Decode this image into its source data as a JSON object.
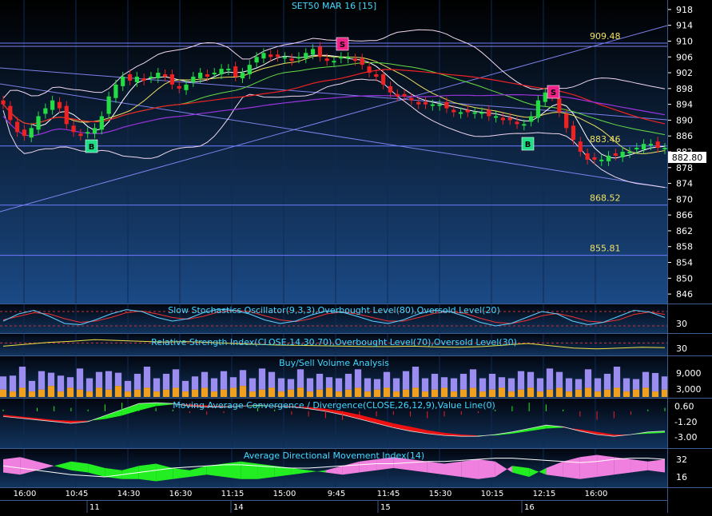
{
  "window": {
    "title": "SET50 MAR 16   [15]",
    "last_price_badge": "882.80"
  },
  "colors": {
    "bg_top": "#000000",
    "bg_bottom": "#1b4a86",
    "grid": "#0f2a55",
    "up_candle": "#22dd44",
    "down_candle": "#ee2222",
    "level_line": "#6c7cff",
    "level_label": "#f0e060",
    "axis_text": "#ffffff",
    "panel_title": "#40d8ff",
    "buy_marker": "#22dd88",
    "sell_marker": "#ee2288"
  },
  "chart_data": [
    {
      "id": "price",
      "type": "candlestick",
      "title": "SET50 MAR 16   [15]",
      "yaxis_ticks": [
        918,
        914,
        910,
        906,
        902,
        898,
        894,
        890,
        886,
        882,
        878,
        874,
        870,
        866,
        862,
        858,
        854,
        850,
        846
      ],
      "ylim": [
        844,
        920
      ],
      "x_ticks": [
        "16:00",
        "10:45",
        "14:30",
        "16:30",
        "11:15",
        "15:00",
        "9:45",
        "11:45",
        "15:30",
        "10:15",
        "12:15",
        "16:00"
      ],
      "date_labels": [
        "11",
        "14",
        "15",
        "16"
      ],
      "levels": [
        {
          "label": "909.48",
          "value": 909.48
        },
        {
          "label": "883.46",
          "value": 883.46
        },
        {
          "label": "868.52",
          "value": 868.52
        },
        {
          "label": "855.81",
          "value": 855.81
        }
      ],
      "last_price": 882.8,
      "closes": [
        894,
        890,
        887,
        886,
        888,
        891,
        893,
        895,
        893,
        889,
        887,
        886,
        887,
        888,
        891,
        896,
        899,
        901,
        900,
        901,
        900,
        901,
        902,
        901,
        899,
        898,
        899,
        901,
        902,
        901,
        902,
        903,
        903,
        901,
        902,
        904,
        906,
        907,
        906,
        906,
        906,
        905,
        906,
        907,
        908,
        906,
        905,
        905,
        906,
        906,
        905,
        904,
        902,
        901,
        899,
        897,
        896,
        896,
        895,
        894,
        894,
        894,
        894,
        893,
        892,
        892,
        892,
        892,
        892,
        891,
        891,
        890,
        890,
        889,
        889,
        891,
        895,
        897,
        896,
        892,
        888,
        885,
        882,
        880,
        880,
        880,
        881,
        881,
        882,
        882,
        883,
        884,
        884,
        883,
        883
      ],
      "signals": [
        {
          "label": "B",
          "type": "buy"
        },
        {
          "label": "S",
          "type": "sell"
        },
        {
          "label": "B",
          "type": "buy"
        },
        {
          "label": "S",
          "type": "sell"
        }
      ],
      "overlays": [
        "bollinger-bands",
        "moving-averages",
        "trend-lines"
      ]
    },
    {
      "id": "stoch",
      "type": "line",
      "title": "Slow Stochastics Oscillator(9,3,3),Overbought Level(80),Oversold Level(20)",
      "yaxis_ticks": [
        30
      ],
      "series": [
        {
          "name": "%K",
          "values": [
            40,
            70,
            85,
            60,
            30,
            25,
            45,
            70,
            88,
            80,
            55,
            40,
            50,
            75,
            90,
            85,
            70,
            45,
            30,
            40,
            65,
            82,
            78,
            60,
            40,
            30,
            45,
            70,
            85,
            80,
            60,
            35,
            20,
            30,
            55,
            80,
            70,
            40,
            25,
            35,
            60,
            85,
            78,
            55
          ]
        },
        {
          "name": "%D",
          "values": [
            45,
            60,
            75,
            70,
            50,
            35,
            40,
            55,
            75,
            82,
            70,
            55,
            48,
            60,
            78,
            85,
            80,
            62,
            45,
            38,
            50,
            70,
            78,
            70,
            55,
            40,
            40,
            55,
            72,
            80,
            72,
            52,
            35,
            30,
            42,
            62,
            72,
            58,
            40,
            35,
            45,
            68,
            78,
            68
          ]
        }
      ]
    },
    {
      "id": "rsi",
      "type": "line",
      "title": "Relative Strength Index(CLOSE,14,30,70),Overbought Level(70),Oversold Level(30)",
      "yaxis_ticks": [
        30
      ],
      "series": [
        {
          "name": "RSI",
          "values": [
            45,
            50,
            55,
            58,
            62,
            60,
            58,
            56,
            57,
            55,
            52,
            50,
            48,
            47,
            46,
            45,
            44,
            44,
            45,
            43,
            42,
            44,
            48,
            52,
            46,
            40,
            38,
            40,
            42,
            41
          ]
        }
      ]
    },
    {
      "id": "volume",
      "type": "bar",
      "title": "Buy/Sell Volume Analysis",
      "yaxis_ticks": [
        "9,000",
        "3,000"
      ],
      "series": [
        {
          "name": "buy",
          "values": [
            5,
            6,
            8,
            4,
            7,
            5,
            6,
            4,
            8,
            5,
            6,
            7,
            5,
            4,
            6,
            8,
            5,
            6,
            7,
            4,
            5,
            6,
            5,
            7,
            4,
            6,
            5,
            8,
            6,
            5,
            4,
            7,
            5,
            6,
            4,
            5,
            6,
            7,
            5,
            4,
            6,
            5,
            7,
            8,
            5,
            6,
            4,
            5,
            6,
            7,
            5,
            6,
            4,
            5,
            7,
            6,
            5,
            8,
            6,
            5,
            4,
            7,
            5,
            6,
            8,
            5,
            4,
            6,
            7,
            5
          ]
        },
        {
          "name": "sell",
          "values": [
            4,
            3,
            5,
            3,
            4,
            6,
            3,
            5,
            4,
            3,
            5,
            4,
            6,
            3,
            4,
            5,
            3,
            4,
            5,
            3,
            4,
            5,
            3,
            4,
            5,
            6,
            3,
            4,
            5,
            3,
            4,
            5,
            3,
            4,
            5,
            3,
            4,
            5,
            3,
            4,
            5,
            3,
            4,
            5,
            3,
            4,
            5,
            3,
            4,
            5,
            3,
            4,
            5,
            3,
            4,
            5,
            3,
            4,
            5,
            3,
            4,
            5,
            3,
            4,
            5,
            3,
            4,
            5,
            3,
            4
          ]
        }
      ]
    },
    {
      "id": "macd",
      "type": "area",
      "title": "Moving Average Convergence / Divergence(CLOSE,26,12,9),Value Line(0)",
      "yaxis_ticks": [
        0.6,
        -1.2,
        -3.0
      ],
      "ylim": [
        -4.0,
        1.2
      ],
      "series": [
        {
          "name": "MACD",
          "values": [
            -0.6,
            -0.8,
            -1.0,
            -1.2,
            -1.4,
            -1.2,
            -0.5,
            0.2,
            0.9,
            1.0,
            0.9,
            0.6,
            0.5,
            0.5,
            0.6,
            0.7,
            0.6,
            0.5,
            0.3,
            0.0,
            -0.4,
            -0.9,
            -1.4,
            -1.9,
            -2.3,
            -2.6,
            -2.8,
            -2.9,
            -2.9,
            -2.7,
            -2.4,
            -2.0,
            -1.6,
            -1.8,
            -2.3,
            -2.7,
            -2.9,
            -2.7,
            -2.4,
            -2.3
          ]
        },
        {
          "name": "Signal",
          "values": [
            -0.4,
            -0.6,
            -0.8,
            -1.0,
            -1.1,
            -1.1,
            -0.9,
            -0.5,
            0.1,
            0.6,
            0.8,
            0.8,
            0.7,
            0.6,
            0.6,
            0.6,
            0.6,
            0.6,
            0.5,
            0.3,
            0.0,
            -0.4,
            -0.9,
            -1.4,
            -1.8,
            -2.2,
            -2.5,
            -2.7,
            -2.8,
            -2.8,
            -2.6,
            -2.3,
            -2.0,
            -1.9,
            -2.1,
            -2.4,
            -2.7,
            -2.7,
            -2.6,
            -2.5
          ]
        }
      ],
      "hist": [
        0.1,
        0.0,
        0.2,
        0.3,
        0.2,
        0.1,
        0.4,
        0.5,
        0.3,
        0.2,
        0.1,
        -0.1,
        -0.2,
        -0.1,
        0.0,
        0.2,
        0.1,
        -0.2,
        -0.3,
        -0.4,
        -0.5,
        -0.4,
        -0.3,
        -0.2,
        -0.3,
        -0.4,
        -0.3,
        -0.2,
        -0.1,
        0.1,
        0.3,
        0.5,
        0.4,
        0.1,
        -0.3,
        -0.5,
        -0.4,
        -0.2,
        0.1,
        0.2
      ]
    },
    {
      "id": "adx",
      "type": "area",
      "title": "Average Directional Movement Index(14)",
      "yaxis_ticks": [
        32,
        16
      ],
      "ylim": [
        8,
        40
      ],
      "series": [
        {
          "name": "ADX",
          "values": [
            26,
            24,
            22,
            20,
            18,
            17,
            16,
            18,
            20,
            22,
            24,
            25,
            26,
            27,
            27,
            26,
            25,
            24,
            24,
            25,
            26,
            27,
            28,
            28,
            29,
            30,
            30,
            31,
            32,
            33,
            33,
            32,
            31,
            30,
            29,
            30,
            32,
            33,
            33,
            32
          ]
        },
        {
          "name": "+DI",
          "values": [
            20,
            18,
            22,
            26,
            30,
            28,
            24,
            22,
            26,
            28,
            24,
            22,
            26,
            28,
            30,
            28,
            26,
            24,
            22,
            20,
            18,
            20,
            22,
            24,
            22,
            20,
            18,
            16,
            14,
            16,
            26,
            24,
            18,
            16,
            14,
            16,
            18,
            20,
            22,
            20
          ]
        },
        {
          "name": "-DI",
          "values": [
            32,
            34,
            30,
            26,
            22,
            20,
            16,
            14,
            14,
            12,
            14,
            16,
            18,
            16,
            14,
            14,
            16,
            18,
            20,
            22,
            26,
            30,
            32,
            34,
            32,
            30,
            28,
            30,
            32,
            30,
            20,
            16,
            24,
            30,
            34,
            36,
            34,
            32,
            30,
            32
          ]
        }
      ]
    }
  ]
}
